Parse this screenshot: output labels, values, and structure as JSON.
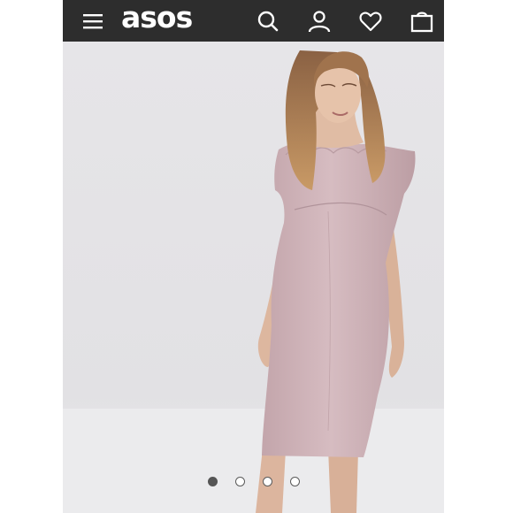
{
  "header": {
    "logo_text": "asos",
    "icons": [
      "menu-icon",
      "search-icon",
      "account-icon",
      "wishlist-heart-icon",
      "shopping-bag-icon"
    ]
  },
  "colors": {
    "header_bg": "#2d2d2d",
    "header_fg": "#ffffff",
    "image_bg": "#e4e3e6",
    "dress": "#cdb1b6"
  },
  "carousel": {
    "total_slides": 4,
    "active_slide": 1
  }
}
